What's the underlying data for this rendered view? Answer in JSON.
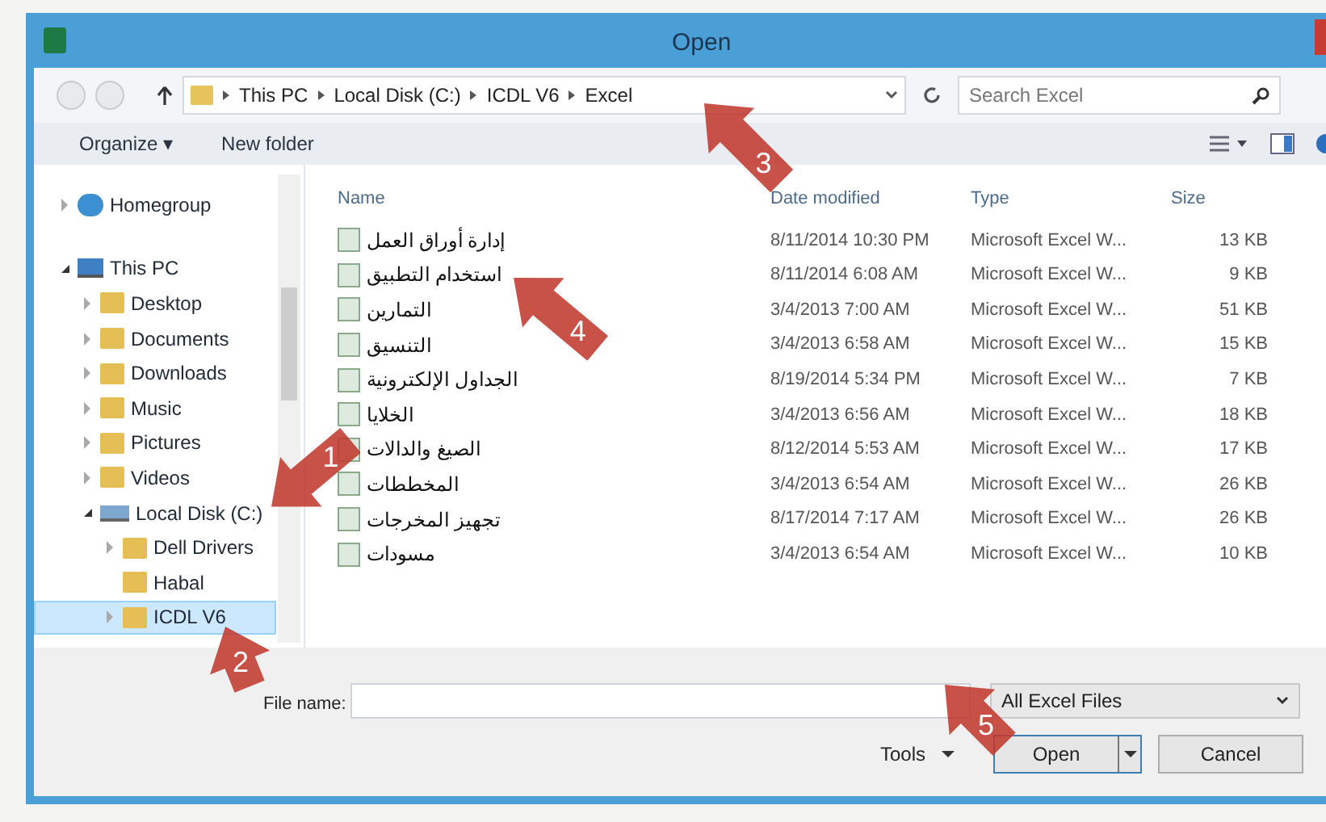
{
  "window": {
    "title": "Open"
  },
  "address_bar": {
    "path": [
      "This PC",
      "Local Disk (C:)",
      "ICDL V6",
      "Excel"
    ]
  },
  "search": {
    "placeholder": "Search Excel"
  },
  "toolbar": {
    "buttons": [
      "Organize ▾",
      "New folder"
    ]
  },
  "sidebar": {
    "items": [
      {
        "label": "Homegroup",
        "kind": "homegroup",
        "expanded": false,
        "selected": false
      },
      {
        "label": "This PC",
        "kind": "pc",
        "expanded": true,
        "selected": false,
        "children": [
          {
            "label": "Desktop",
            "kind": "folder",
            "expanded": false,
            "selected": false
          },
          {
            "label": "Documents",
            "kind": "folder",
            "expanded": false,
            "selected": false
          },
          {
            "label": "Downloads",
            "kind": "folder",
            "expanded": false,
            "selected": false
          },
          {
            "label": "Music",
            "kind": "folder",
            "expanded": false,
            "selected": false
          },
          {
            "label": "Pictures",
            "kind": "folder",
            "expanded": false,
            "selected": false
          },
          {
            "label": "Videos",
            "kind": "folder",
            "expanded": false,
            "selected": false
          },
          {
            "label": "Local Disk (C:)",
            "kind": "drive",
            "expanded": true,
            "selected": false,
            "children": [
              {
                "label": "Dell Drivers",
                "kind": "folder",
                "expanded": false,
                "selected": false
              },
              {
                "label": "Habal",
                "kind": "folder",
                "selected": false
              },
              {
                "label": "ICDL V6",
                "kind": "folder",
                "expanded": false,
                "selected": true
              }
            ]
          }
        ]
      }
    ]
  },
  "file_list": {
    "columns": [
      "Name",
      "Date modified",
      "Type",
      "Size"
    ],
    "rows": [
      {
        "name": "إدارة أوراق العمل",
        "date": "8/11/2014 10:30 PM",
        "type": "Microsoft Excel W...",
        "size": "13 KB"
      },
      {
        "name": "استخدام التطبيق",
        "date": "8/11/2014 6:08 AM",
        "type": "Microsoft Excel W...",
        "size": "9 KB"
      },
      {
        "name": "التمارين",
        "date": "3/4/2013 7:00 AM",
        "type": "Microsoft Excel W...",
        "size": "51 KB"
      },
      {
        "name": "التنسيق",
        "date": "3/4/2013 6:58 AM",
        "type": "Microsoft Excel W...",
        "size": "15 KB"
      },
      {
        "name": "الجداول الإلكترونية",
        "date": "8/19/2014 5:34 PM",
        "type": "Microsoft Excel W...",
        "size": "7 KB"
      },
      {
        "name": "الخلايا",
        "date": "3/4/2013 6:56 AM",
        "type": "Microsoft Excel W...",
        "size": "18 KB"
      },
      {
        "name": "الصيغ والدالات",
        "date": "8/12/2014 5:53 AM",
        "type": "Microsoft Excel W...",
        "size": "17 KB"
      },
      {
        "name": "المخططات",
        "date": "3/4/2013 6:54 AM",
        "type": "Microsoft Excel W...",
        "size": "26 KB"
      },
      {
        "name": "تجهيز المخرجات",
        "date": "8/17/2014 7:17 AM",
        "type": "Microsoft Excel W...",
        "size": "26 KB"
      },
      {
        "name": "مسودات",
        "date": "3/4/2013 6:54 AM",
        "type": "Microsoft Excel W...",
        "size": "10 KB"
      }
    ]
  },
  "footer": {
    "file_name_label": "File name:",
    "file_type": "All Excel Files",
    "buttons": [
      "Tools",
      "Open",
      "Cancel"
    ]
  },
  "callouts": [
    "1",
    "2",
    "3",
    "4",
    "5"
  ]
}
